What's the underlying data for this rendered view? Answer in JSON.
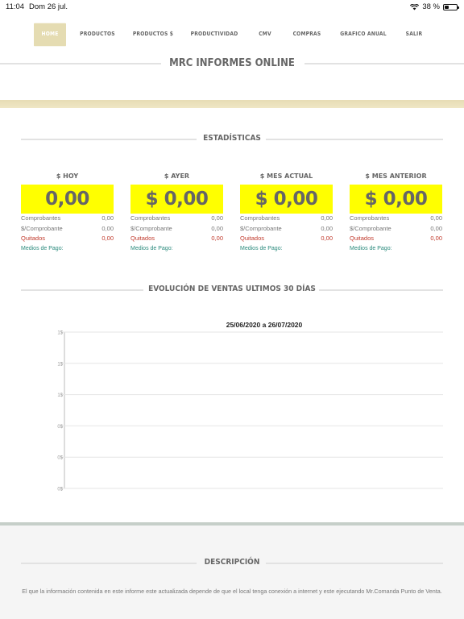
{
  "status_bar": {
    "time": "11:04",
    "date": "Dom 26 jul.",
    "battery": "38 %",
    "battery_level": 0.38
  },
  "nav": {
    "items": [
      {
        "label": "HOME",
        "active": true
      },
      {
        "label": "PRODUCTOS",
        "active": false
      },
      {
        "label": "PRODUCTOS $",
        "active": false
      },
      {
        "label": "PRODUCTIVIDAD",
        "active": false
      },
      {
        "label": "CMV",
        "active": false
      },
      {
        "label": "COMPRAS",
        "active": false
      },
      {
        "label": "GRAFICO ANUAL",
        "active": false
      },
      {
        "label": "SALIR",
        "active": false
      }
    ]
  },
  "header": {
    "title": "MRC INFORMES ONLINE"
  },
  "stats_section": {
    "title": "ESTADÍSTICAS"
  },
  "stats": [
    {
      "label": "$ HOY",
      "value": "0,00",
      "comprobantes_label": "Comprobantes",
      "comprobantes": "0,00",
      "per_comp_label": "$/Comprobante",
      "per_comp": "0,00",
      "quitados_label": "Quitados",
      "quitados": "0,00",
      "medios_label": "Medios de Pago:"
    },
    {
      "label": "$ AYER",
      "value": "$ 0,00",
      "comprobantes_label": "Comprobantes",
      "comprobantes": "0,00",
      "per_comp_label": "$/Comprobante",
      "per_comp": "0,00",
      "quitados_label": "Quitados",
      "quitados": "0,00",
      "medios_label": "Medios de Pago:"
    },
    {
      "label": "$ MES ACTUAL",
      "value": "$ 0,00",
      "comprobantes_label": "Comprobantes",
      "comprobantes": "0,00",
      "per_comp_label": "$/Comprobante",
      "per_comp": "0,00",
      "quitados_label": "Quitados",
      "quitados": "0,00",
      "medios_label": "Medios de Pago:"
    },
    {
      "label": "$ MES ANTERIOR",
      "value": "$ 0,00",
      "comprobantes_label": "Comprobantes",
      "comprobantes": "0,00",
      "per_comp_label": "$/Comprobante",
      "per_comp": "0,00",
      "quitados_label": "Quitados",
      "quitados": "0,00",
      "medios_label": "Medios de Pago:"
    }
  ],
  "sales_section": {
    "title": "EVOLUCIÓN DE VENTAS ULTIMOS 30 DÍAS"
  },
  "chart_data": {
    "type": "line",
    "title": "25/06/2020 a 26/07/2020",
    "xlabel": "",
    "ylabel": "",
    "y_tick_labels": [
      "1$",
      "1$",
      "1$",
      "0$",
      "0$",
      "0$"
    ],
    "grid": true,
    "series": []
  },
  "description": {
    "title": "DESCRIPCIÓN",
    "text": "El que la información contenida en este informe este actualizada depende de que el local tenga conexión a internet y este ejecutando Mr.Comanda Punto de Venta."
  },
  "colors": {
    "accent_yellow": "#ffff00",
    "beige": "#e5dcb2",
    "red": "#c0392b",
    "teal": "#2a8a7c"
  }
}
